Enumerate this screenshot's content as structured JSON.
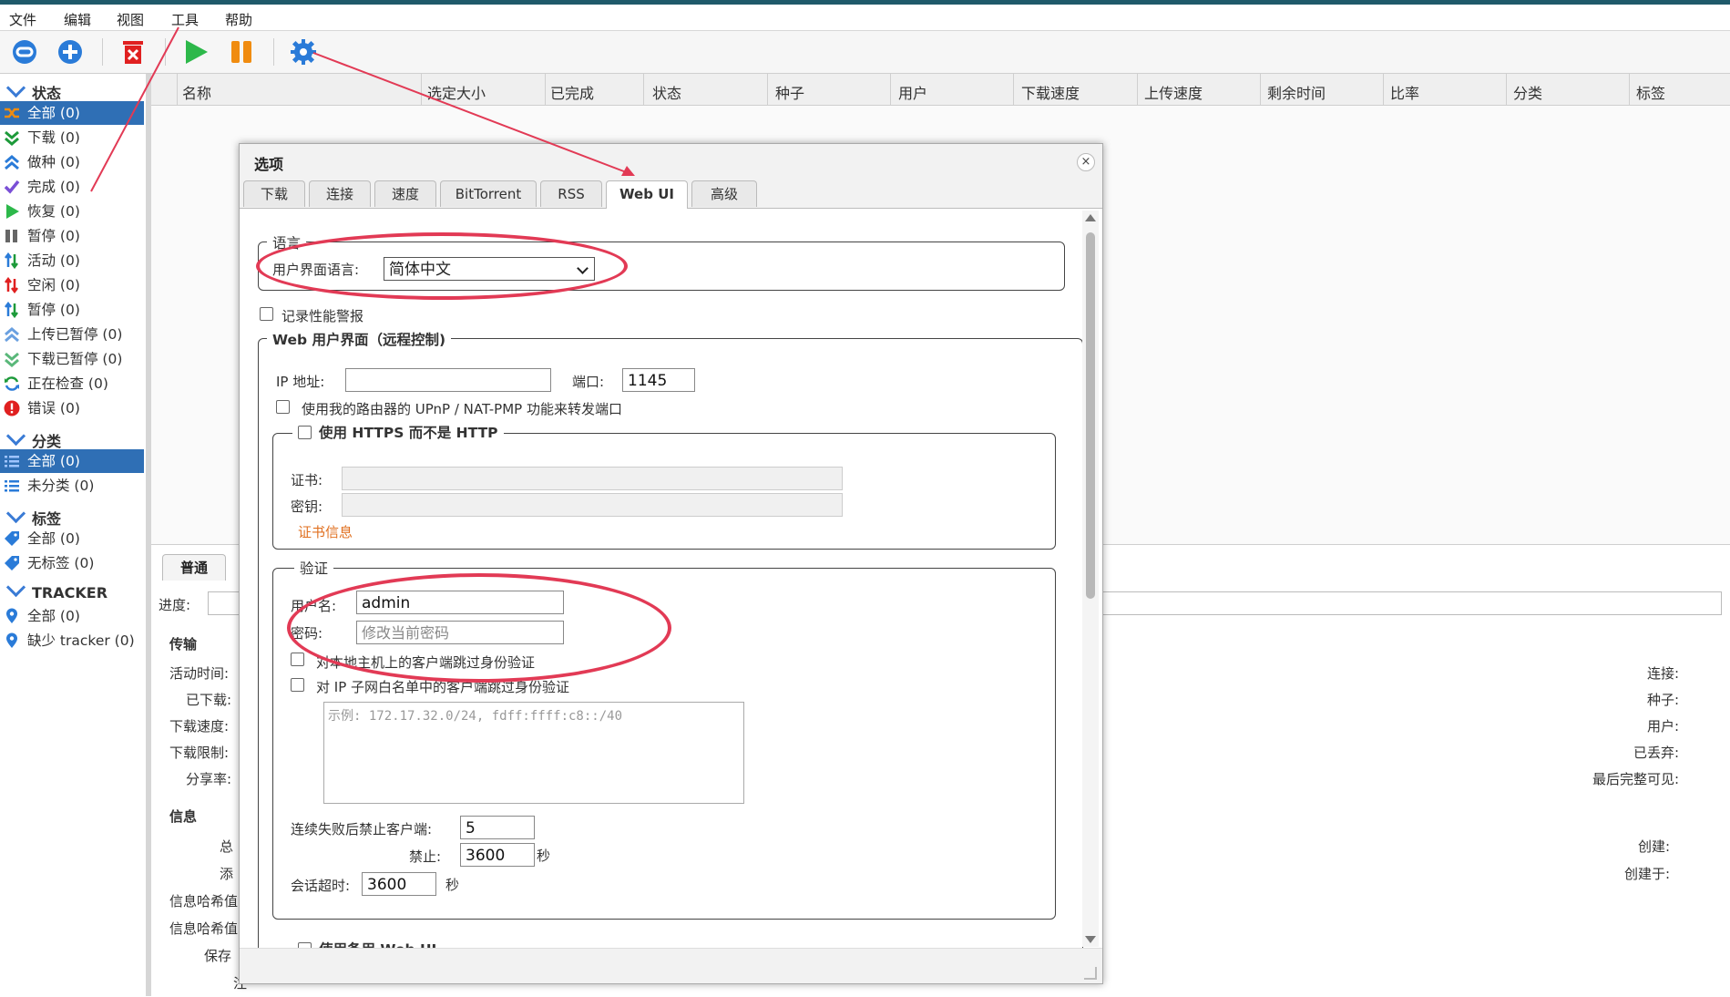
{
  "menu": [
    "文件",
    "编辑",
    "视图",
    "工具",
    "帮助"
  ],
  "sidebar": {
    "status_header": "状态",
    "status_items": [
      "全部 (0)",
      "下载 (0)",
      "做种 (0)",
      "完成 (0)",
      "恢复 (0)",
      "暂停 (0)",
      "活动 (0)",
      "空闲 (0)",
      "暂停 (0)",
      "上传已暂停 (0)",
      "下载已暂停 (0)",
      "正在检查 (0)",
      "错误 (0)"
    ],
    "category_header": "分类",
    "category_items": [
      "全部 (0)",
      "未分类 (0)"
    ],
    "tag_header": "标签",
    "tag_items": [
      "全部 (0)",
      "无标签 (0)"
    ],
    "tracker_header": "TRACKER",
    "tracker_items": [
      "全部 (0)",
      "缺少 tracker (0)"
    ]
  },
  "columns": [
    "名称",
    "选定大小",
    "已完成",
    "状态",
    "种子",
    "用户",
    "下载速度",
    "上传速度",
    "剩余时间",
    "比率",
    "分类",
    "标签"
  ],
  "lower": {
    "tab_general": "普通",
    "progress_label": "进度:",
    "transfer_legend": "传输",
    "transfer_labels": [
      "活动时间:",
      "已下载:",
      "下载速度:",
      "下载限制:",
      "分享率:"
    ],
    "right_labels": [
      "连接:",
      "种子:",
      "用户:",
      "已丢弃:",
      "最后完整可见:"
    ],
    "info_legend": "信息",
    "info_labels": [
      "总",
      "添",
      "信息哈希值",
      "信息哈希值",
      "保存",
      "注"
    ],
    "info_right": [
      "创建:",
      "创建于:"
    ]
  },
  "dialog": {
    "title": "选项",
    "close": "×",
    "tabs": [
      "下载",
      "连接",
      "速度",
      "BitTorrent",
      "RSS",
      "Web UI",
      "高级"
    ],
    "language_legend": "语言",
    "ui_language_label": "用户界面语言:",
    "ui_language_value": "简体中文",
    "log_perf_label": "记录性能警报",
    "webui_legend": "Web 用户界面（远程控制)",
    "ip_label": "IP 地址:",
    "ip_value": "",
    "port_label": "端口:",
    "port_value": "1145",
    "upnp_label": "使用我的路由器的 UPnP / NAT-PMP 功能来转发端口",
    "https_legend": "使用 HTTPS 而不是 HTTP",
    "cert_label": "证书:",
    "key_label": "密钥:",
    "cert_info": "证书信息",
    "auth_legend": "验证",
    "username_label": "用户名:",
    "username_value": "admin",
    "password_label": "密码:",
    "password_placeholder": "修改当前密码",
    "bypass_local": "对本地主机上的客户端跳过身份验证",
    "bypass_subnet": "对 IP 子网白名单中的客户端跳过身份验证",
    "subnet_placeholder": "示例: 172.17.32.0/24, fdff:ffff:c8::/40",
    "ban_after_label": "连续失败后禁止客户端:",
    "ban_after_value": "5",
    "ban_label": "禁止:",
    "ban_value": "3600",
    "ban_unit": "秒",
    "session_label": "会话超时:",
    "session_value": "3600",
    "session_unit": "秒",
    "alt_webui_legend": "使用备用 Web UI"
  },
  "colors": {
    "accent": "#2f6fb5",
    "annotation": "#e23a55",
    "topbar": "#1f5a6a"
  }
}
